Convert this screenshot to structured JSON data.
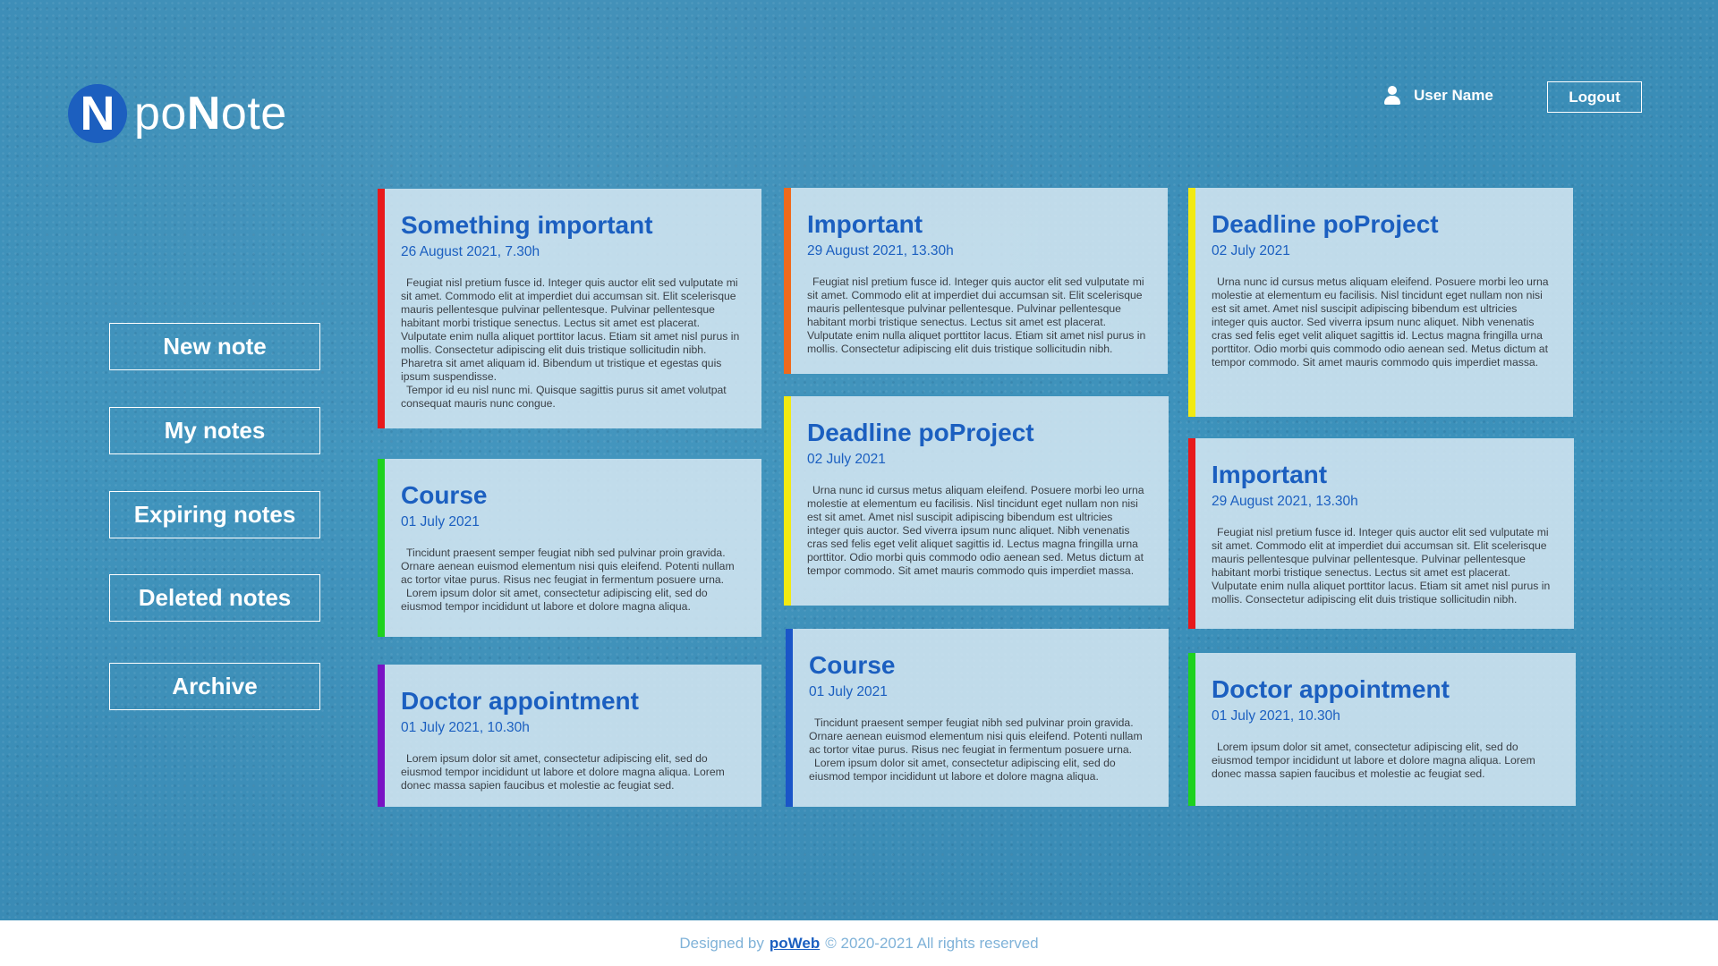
{
  "brand": {
    "logo_letter": "N",
    "name_pre": "po",
    "name_bold": "N",
    "name_post": "ote"
  },
  "header": {
    "user_name": "User Name",
    "logout_label": "Logout"
  },
  "sidebar": {
    "items": [
      {
        "label": "New note"
      },
      {
        "label": "My notes"
      },
      {
        "label": "Expiring notes"
      },
      {
        "label": "Deleted notes"
      },
      {
        "label": "Archive"
      }
    ]
  },
  "notes": [
    {
      "title": "Something important",
      "date": "26 August 2021, 7.30h",
      "color": "#e8191b",
      "p1": "Feugiat nisl pretium fusce id. Integer quis auctor elit sed vulputate mi sit amet. Commodo elit at imperdiet dui accumsan sit. Elit scelerisque mauris pellentesque pulvinar pellentesque. Pulvinar pellentesque habitant morbi tristique senectus. Lectus sit amet est placerat. Vulputate enim nulla aliquet porttitor lacus. Etiam sit amet nisl purus in mollis. Consectetur adipiscing elit duis tristique sollicitudin nibh. Pharetra sit amet aliquam id. Bibendum ut tristique et egestas quis ipsum suspendisse.",
      "p2": "Tempor id eu nisl nunc mi. Quisque sagittis purus sit amet volutpat consequat mauris nunc congue."
    },
    {
      "title": "Course",
      "date": "01 July 2021",
      "color": "#1ed21e",
      "p1": "Tincidunt praesent semper feugiat nibh sed pulvinar proin gravida. Ornare aenean euismod elementum nisi quis eleifend. Potenti nullam ac tortor vitae purus. Risus nec feugiat in fermentum posuere urna.",
      "p2": "Lorem ipsum dolor sit amet, consectetur adipiscing elit, sed do eiusmod tempor incididunt ut labore et dolore magna aliqua."
    },
    {
      "title": "Doctor appointment",
      "date": "01 July 2021, 10.30h",
      "color": "#7a12c4",
      "p1": "Lorem ipsum dolor sit amet, consectetur adipiscing elit, sed do eiusmod tempor incididunt ut labore et dolore magna aliqua. Lorem donec massa sapien faucibus et molestie ac feugiat sed.",
      "p2": ""
    },
    {
      "title": "Important",
      "date": "29 August 2021, 13.30h",
      "color": "#f06a1c",
      "p1": "Feugiat nisl pretium fusce id. Integer quis auctor elit sed vulputate mi sit amet. Commodo elit at imperdiet dui accumsan sit. Elit scelerisque mauris pellentesque pulvinar pellentesque. Pulvinar pellentesque habitant morbi tristique senectus. Lectus sit amet est placerat. Vulputate enim nulla aliquet porttitor lacus. Etiam sit amet nisl purus in mollis. Consectetur adipiscing elit duis tristique sollicitudin nibh.",
      "p2": ""
    },
    {
      "title": "Deadline poProject",
      "date": "02 July 2021",
      "color": "#f2ea12",
      "p1": "Urna nunc id cursus metus aliquam eleifend. Posuere morbi leo urna molestie at elementum eu facilisis. Nisl tincidunt eget nullam non nisi est sit amet. Amet nisl suscipit adipiscing bibendum est ultricies integer quis auctor. Sed viverra ipsum nunc aliquet. Nibh venenatis cras sed felis eget velit aliquet sagittis id. Lectus magna fringilla urna porttitor. Odio morbi quis commodo odio aenean sed. Metus dictum at tempor commodo. Sit amet mauris commodo quis imperdiet massa.",
      "p2": ""
    },
    {
      "title": "Course",
      "date": "01 July 2021",
      "color": "#1a55c8",
      "p1": "Tincidunt praesent semper feugiat nibh sed pulvinar proin gravida. Ornare aenean euismod elementum nisi quis eleifend. Potenti nullam ac tortor vitae purus. Risus nec feugiat in fermentum posuere urna.",
      "p2": "Lorem ipsum dolor sit amet, consectetur adipiscing elit, sed do eiusmod tempor incididunt ut labore et dolore magna aliqua."
    },
    {
      "title": "Deadline poProject",
      "date": "02 July 2021",
      "color": "#f2ea12",
      "p1": "Urna nunc id cursus metus aliquam eleifend. Posuere morbi leo urna molestie at elementum eu facilisis. Nisl tincidunt eget nullam non nisi est sit amet. Amet nisl suscipit adipiscing bibendum est ultricies integer quis auctor. Sed viverra ipsum nunc aliquet. Nibh venenatis cras sed felis eget velit aliquet sagittis id. Lectus magna fringilla urna porttitor. Odio morbi quis commodo odio aenean sed. Metus dictum at tempor commodo. Sit amet mauris commodo quis imperdiet massa.",
      "p2": ""
    },
    {
      "title": "Important",
      "date": "29 August 2021, 13.30h",
      "color": "#e8191b",
      "p1": "Feugiat nisl pretium fusce id. Integer quis auctor elit sed vulputate mi sit amet. Commodo elit at imperdiet dui accumsan sit. Elit scelerisque mauris pellentesque pulvinar pellentesque. Pulvinar pellentesque habitant morbi tristique senectus. Lectus sit amet est placerat. Vulputate enim nulla aliquet porttitor lacus. Etiam sit amet nisl purus in mollis. Consectetur adipiscing elit duis tristique sollicitudin nibh.",
      "p2": ""
    },
    {
      "title": "Doctor appointment",
      "date": "01 July 2021, 10.30h",
      "color": "#1ed21e",
      "p1": "Lorem ipsum dolor sit amet, consectetur adipiscing elit, sed do eiusmod tempor incididunt ut labore et dolore magna aliqua. Lorem donec massa sapien faucibus et molestie ac feugiat sed.",
      "p2": ""
    }
  ],
  "footer": {
    "prefix": "Designed by",
    "link": "poWeb",
    "suffix": "© 2020-2021 All rights reserved"
  }
}
